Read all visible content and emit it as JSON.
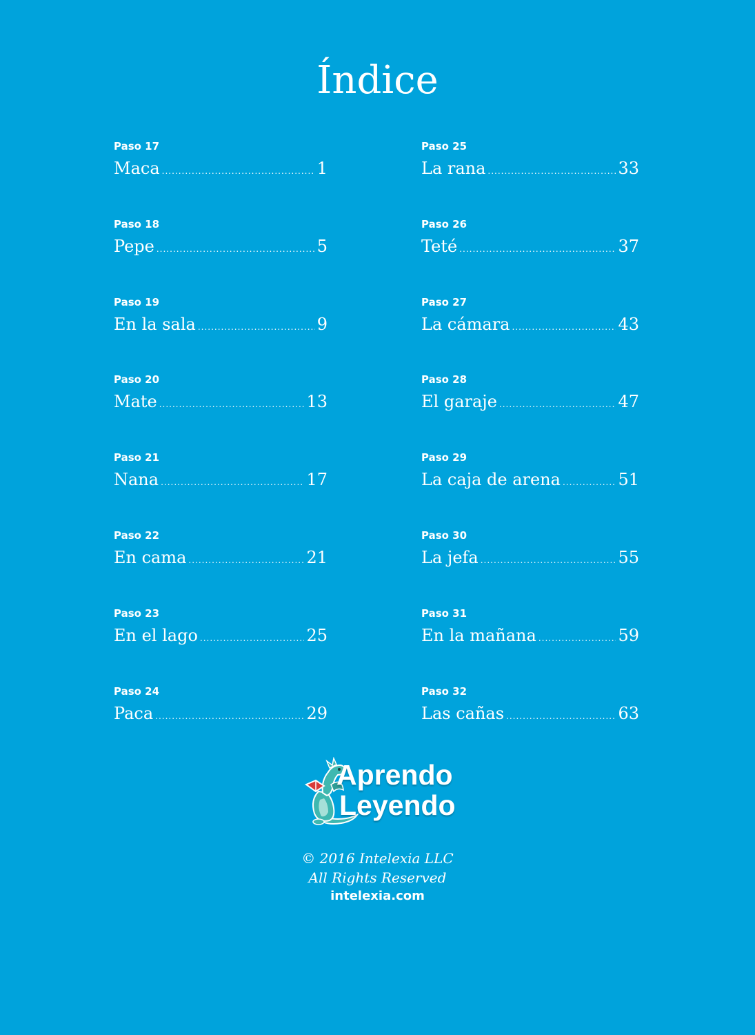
{
  "title": "Índice",
  "toc_left": [
    {
      "paso": "Paso 17",
      "title": "Maca",
      "page": "1"
    },
    {
      "paso": "Paso 18",
      "title": "Pepe",
      "page": "5"
    },
    {
      "paso": "Paso 19",
      "title": "En la sala",
      "page": "9"
    },
    {
      "paso": "Paso 20",
      "title": "Mate",
      "page": "13"
    },
    {
      "paso": "Paso 21",
      "title": "Nana",
      "page": "17"
    },
    {
      "paso": "Paso 22",
      "title": "En cama",
      "page": "21"
    },
    {
      "paso": "Paso 23",
      "title": "En el lago",
      "page": "25"
    },
    {
      "paso": "Paso 24",
      "title": "Paca",
      "page": "29"
    }
  ],
  "toc_right": [
    {
      "paso": "Paso 25",
      "title": "La rana",
      "page": "33"
    },
    {
      "paso": "Paso 26",
      "title": "Teté",
      "page": "37"
    },
    {
      "paso": "Paso 27",
      "title": "La cámara",
      "page": "43"
    },
    {
      "paso": "Paso 28",
      "title": "El garaje",
      "page": "47"
    },
    {
      "paso": "Paso 29",
      "title": "La caja de arena",
      "page": "51"
    },
    {
      "paso": "Paso 30",
      "title": "La jefa",
      "page": "55"
    },
    {
      "paso": "Paso 31",
      "title": "En la mañana",
      "page": "59"
    },
    {
      "paso": "Paso 32",
      "title": "Las cañas",
      "page": "63"
    }
  ],
  "logo": {
    "line1": "Aprendo",
    "line2": "Leyendo",
    "icon": "dragon-reading-book-icon"
  },
  "footer": {
    "copyright": "© 2016 Intelexia LLC",
    "rights": "All Rights Reserved",
    "website": "intelexia.com"
  },
  "colors": {
    "background": "#00a3dc",
    "text": "#ffffff",
    "dragon": "#3fb8b0",
    "book": "#d83a3a"
  }
}
